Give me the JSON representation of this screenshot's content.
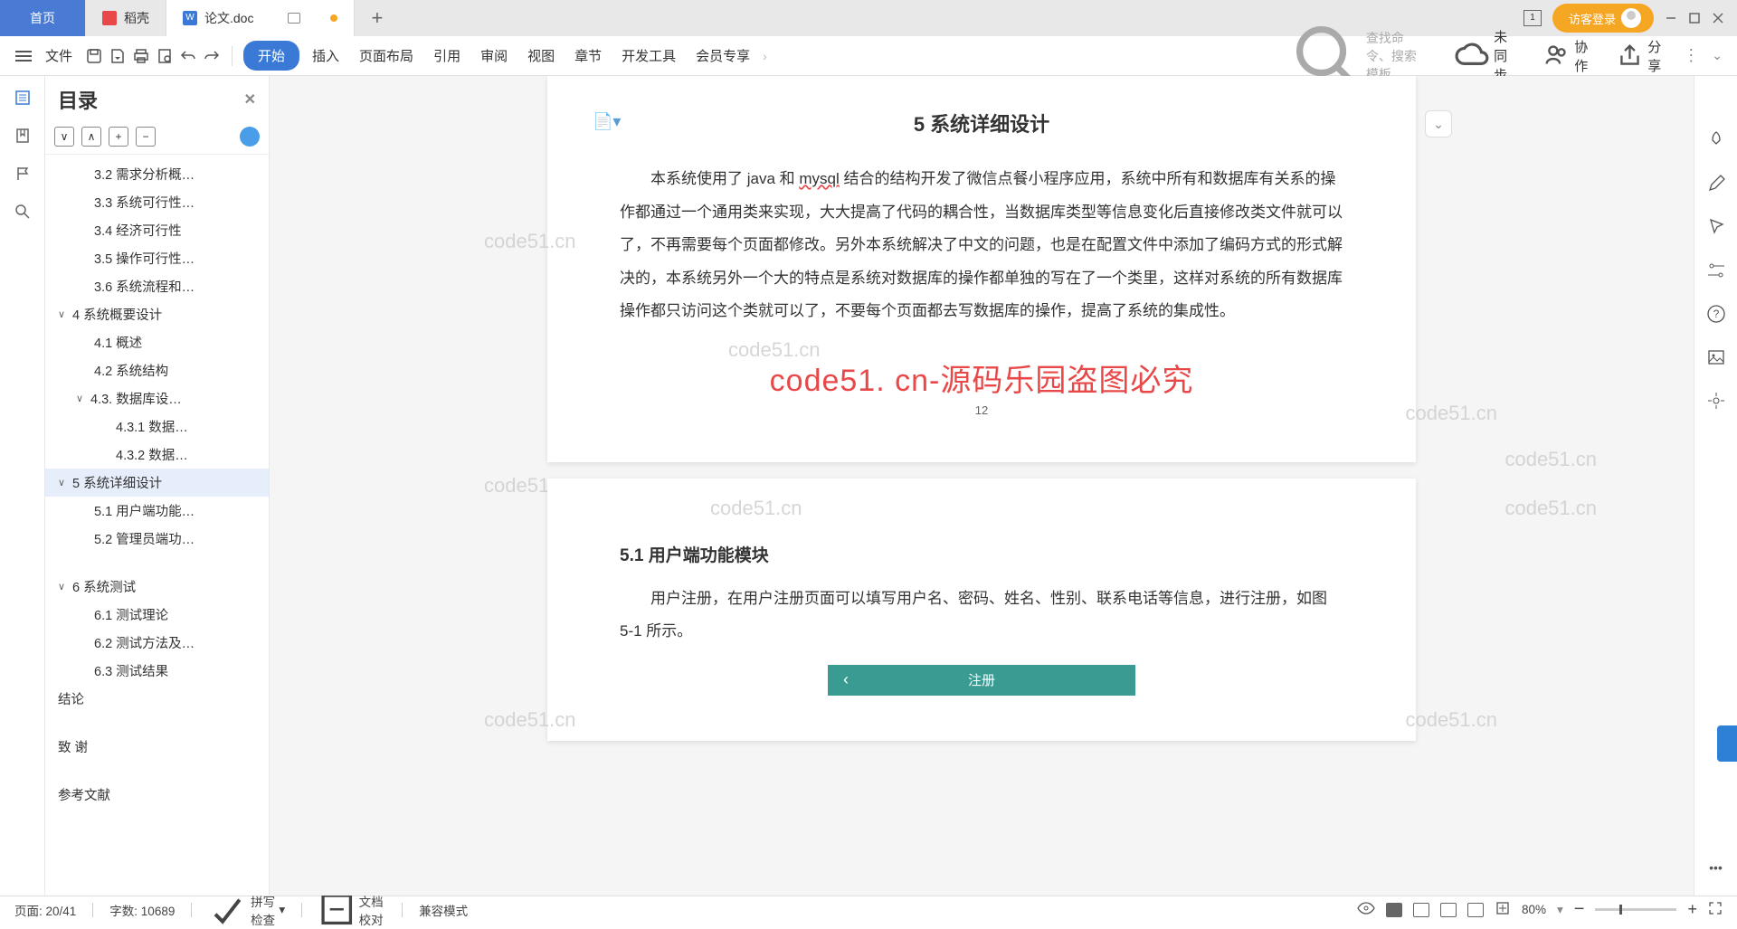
{
  "tabs": {
    "home": "首页",
    "daoke": "稻壳",
    "doc": "论文.doc"
  },
  "title_right": {
    "boxed": "1",
    "login": "访客登录"
  },
  "ribbon": {
    "file": "文件",
    "menus": [
      "开始",
      "插入",
      "页面布局",
      "引用",
      "审阅",
      "视图",
      "章节",
      "开发工具",
      "会员专享"
    ],
    "search_placeholder": "查找命令、搜索模板",
    "unsync": "未同步",
    "collab": "协作",
    "share": "分享"
  },
  "outline": {
    "title": "目录",
    "tools": {
      "collapse": "∨",
      "up": "∧",
      "plus": "+",
      "minus": "−"
    },
    "items": [
      {
        "lv": 2,
        "txt": "3.2 需求分析概…"
      },
      {
        "lv": 2,
        "txt": "3.3 系统可行性…"
      },
      {
        "lv": 2,
        "txt": "3.4 经济可行性"
      },
      {
        "lv": 2,
        "txt": "3.5 操作可行性…"
      },
      {
        "lv": 2,
        "txt": "3.6 系统流程和…"
      },
      {
        "lv": 1,
        "txt": "4 系统概要设计",
        "exp": true
      },
      {
        "lv": 2,
        "txt": "4.1 概述"
      },
      {
        "lv": 2,
        "txt": "4.2  系统结构"
      },
      {
        "lv": 1,
        "txt": "4.3. 数据库设…",
        "exp": true,
        "sub": true
      },
      {
        "lv": 3,
        "txt": "4.3.1 数据…"
      },
      {
        "lv": 3,
        "txt": "4.3.2 数据…"
      },
      {
        "lv": 1,
        "txt": "5 系统详细设计",
        "exp": true,
        "active": true
      },
      {
        "lv": 2,
        "txt": "5.1 用户端功能…"
      },
      {
        "lv": 2,
        "txt": "5.2 管理员端功…"
      },
      {
        "lv": 1,
        "txt": "6  系统测试",
        "exp": true,
        "gap": true
      },
      {
        "lv": 2,
        "txt": "6.1 测试理论"
      },
      {
        "lv": 2,
        "txt": "6.2 测试方法及…"
      },
      {
        "lv": 2,
        "txt": "6.3 测试结果"
      },
      {
        "lv": 1,
        "txt": "结论",
        "plain": true
      },
      {
        "lv": 1,
        "txt": "致  谢",
        "plain": true,
        "gap": true
      },
      {
        "lv": 1,
        "txt": "参考文献",
        "plain": true,
        "gap": true
      }
    ]
  },
  "doc": {
    "h1": "5 系统详细设计",
    "p1a": "本系统使用了 java 和 ",
    "p1u": "mysql",
    "p1b": " 结合的结构开发了微信点餐小程序应用，系统中所有和数据库有关系的操作都通过一个通用类来实现，大大提高了代码的耦合性，当数据库类型等信息变化后直接修改类文件就可以了，不再需要每个页面都修改。另外本系统解决了中文的问题，也是在配置文件中添加了编码方式的形式解决的，本系统另外一个大的特点是系统对数据库的操作都单独的写在了一个类里，这样对系统的所有数据库操作都只访问这个类就可以了，不要每个页面都去写数据库的操作，提高了系统的集成性。",
    "watermark_red": "code51. cn-源码乐园盗图必究",
    "page_num": "12",
    "h2": "5.1 用户端功能模块",
    "p2": "用户注册，在用户注册页面可以填写用户名、密码、姓名、性别、联系电话等信息，进行注册，如图 5-1 所示。",
    "reg_label": "注册",
    "wm": "code51.cn"
  },
  "status": {
    "page": "页面: 20/41",
    "words": "字数: 10689",
    "spell": "拼写检查",
    "proof": "文档校对",
    "compat": "兼容模式",
    "zoom": "80%"
  }
}
